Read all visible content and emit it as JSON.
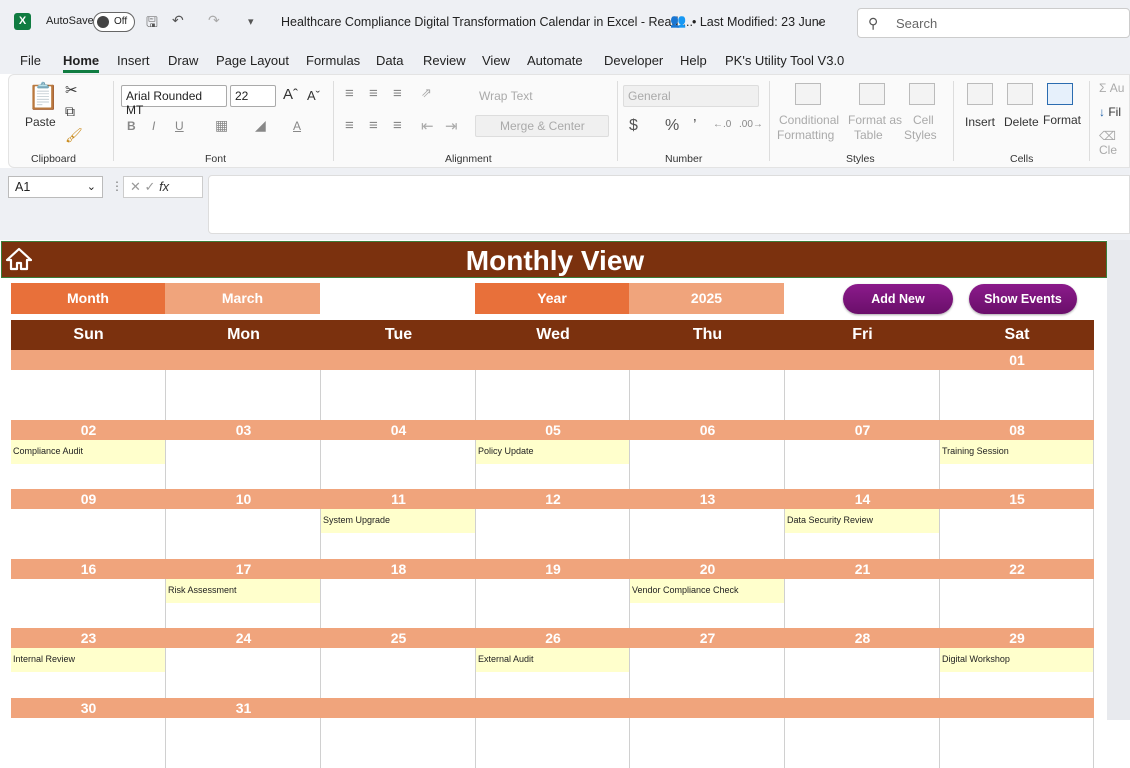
{
  "titlebar": {
    "autosave_label": "AutoSave",
    "autosave_state": "Off",
    "doc_title": "Healthcare Compliance Digital Transformation Calendar in Excel  -  Read-...",
    "last_modified": "•  Last Modified: 23 June",
    "search_placeholder": "Search"
  },
  "menu": [
    "File",
    "Home",
    "Insert",
    "Draw",
    "Page Layout",
    "Formulas",
    "Data",
    "Review",
    "View",
    "Automate",
    "Developer",
    "Help",
    "PK's Utility Tool V3.0"
  ],
  "ribbon": {
    "paste": "Paste",
    "clipboard": "Clipboard",
    "font_name": "Arial Rounded MT",
    "font_size": "22",
    "font": "Font",
    "wrap_text": "Wrap Text",
    "merge_center": "Merge & Center",
    "alignment": "Alignment",
    "number_format": "General",
    "number": "Number",
    "conditional": "Conditional",
    "formatting": "Formatting",
    "format_as": "Format as",
    "table": "Table",
    "cell": "Cell",
    "styles_lbl": "Styles",
    "styles": "Styles",
    "insert": "Insert",
    "delete": "Delete",
    "format": "Format",
    "cells": "Cells",
    "autosum": "Au",
    "fill": "Fil",
    "clear": "Cle"
  },
  "formula_bar": {
    "name_box": "A1",
    "fx": "fx"
  },
  "calendar": {
    "title": "Monthly View",
    "month_label": "Month",
    "month_value": "March",
    "year_label": "Year",
    "year_value": "2025",
    "add_new": "Add New",
    "show_events": "Show Events",
    "days": [
      "Sun",
      "Mon",
      "Tue",
      "Wed",
      "Thu",
      "Fri",
      "Sat"
    ],
    "weeks": [
      {
        "dates": [
          "",
          "",
          "",
          "",
          "",
          "",
          "01"
        ],
        "events": [
          "",
          "",
          "",
          "",
          "",
          "",
          ""
        ]
      },
      {
        "dates": [
          "02",
          "03",
          "04",
          "05",
          "06",
          "07",
          "08"
        ],
        "events": [
          "Compliance Audit",
          "",
          "",
          "Policy Update",
          "",
          "",
          "Training Session"
        ]
      },
      {
        "dates": [
          "09",
          "10",
          "11",
          "12",
          "13",
          "14",
          "15"
        ],
        "events": [
          "",
          "",
          "System Upgrade",
          "",
          "",
          "Data Security Review",
          ""
        ]
      },
      {
        "dates": [
          "16",
          "17",
          "18",
          "19",
          "20",
          "21",
          "22"
        ],
        "events": [
          "",
          "Risk Assessment",
          "",
          "",
          "Vendor Compliance Check",
          "",
          ""
        ]
      },
      {
        "dates": [
          "23",
          "24",
          "25",
          "26",
          "27",
          "28",
          "29"
        ],
        "events": [
          "Internal Review",
          "",
          "",
          "External Audit",
          "",
          "",
          "Digital Workshop"
        ]
      },
      {
        "dates": [
          "30",
          "31",
          "",
          "",
          "",
          "",
          ""
        ],
        "events": [
          "",
          "",
          "",
          "",
          "",
          "",
          ""
        ]
      }
    ]
  },
  "colors": {
    "banner": "#7b310e",
    "selector_label": "#e8703a",
    "selector_value": "#f0a47c",
    "date_bar": "#f0a47c",
    "event_fill": "#ffffcc",
    "button": "#7d167d"
  }
}
